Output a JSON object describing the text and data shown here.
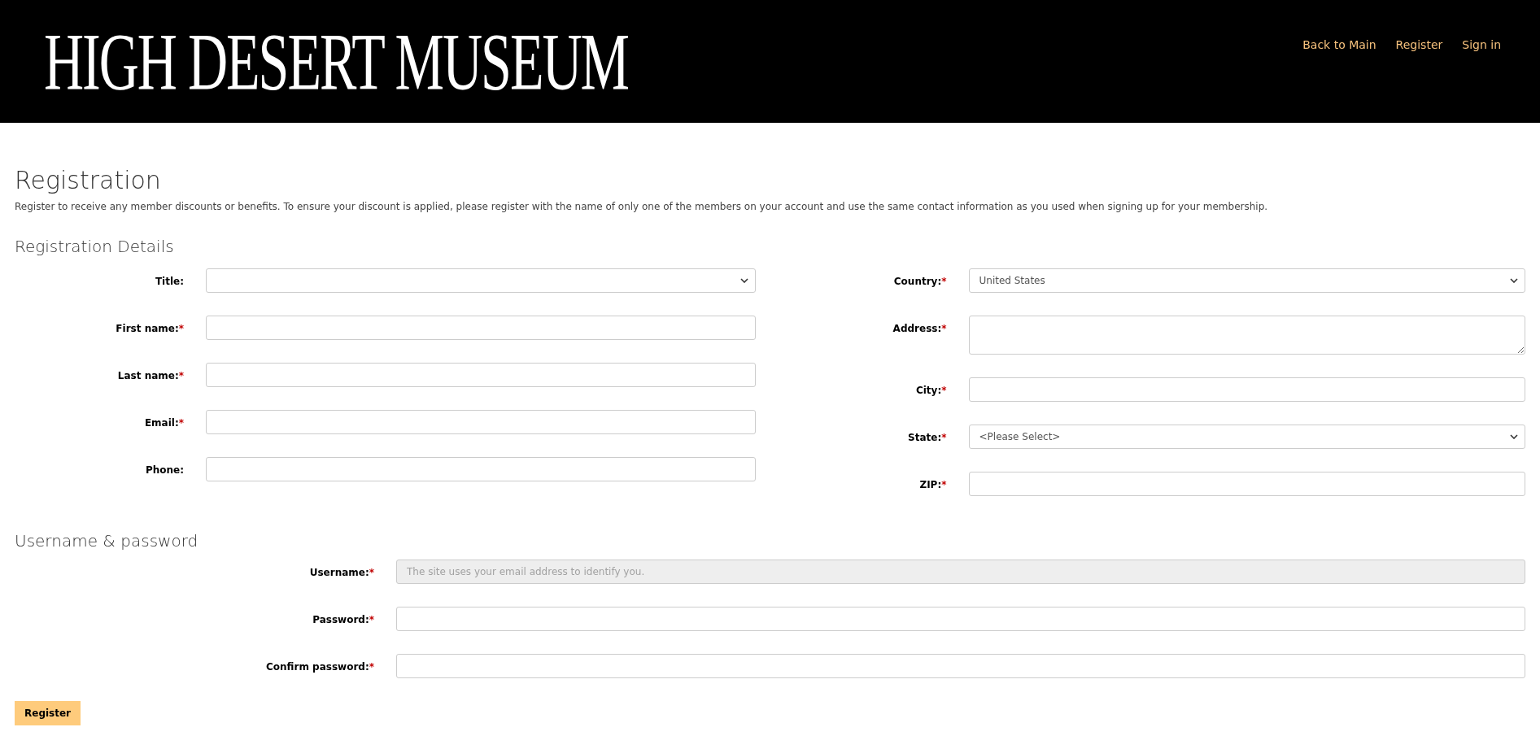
{
  "header": {
    "logo": "HIGH DESERT MUSEUM",
    "nav": [
      "Back to Main",
      "Register",
      "Sign in"
    ]
  },
  "page": {
    "title": "Registration",
    "description": "Register to receive any member discounts or benefits. To ensure your discount is applied, please register with the name of only one of the members on your account and use the same contact information as you used when signing up for your membership."
  },
  "details": {
    "heading": "Registration Details",
    "left_fields": [
      {
        "label": "Title:",
        "kind": "select"
      },
      {
        "label": "First name:",
        "marker": "*",
        "kind": "text"
      },
      {
        "label": "Last name:",
        "marker": "*",
        "kind": "text"
      },
      {
        "label": "Email:",
        "marker": "*",
        "kind": "text"
      },
      {
        "label": "Phone:",
        "kind": "text"
      }
    ],
    "right_fields": [
      {
        "label": "Country:",
        "marker": "*",
        "kind": "select",
        "value": "United States"
      },
      {
        "label": "Address:",
        "marker": "*",
        "kind": "textarea"
      },
      {
        "label": "City:",
        "marker": "*",
        "kind": "text"
      },
      {
        "label": "State:",
        "marker": "*",
        "kind": "select",
        "value": "<Please Select>"
      },
      {
        "label": "ZIP:",
        "marker": "*",
        "kind": "text"
      }
    ]
  },
  "account": {
    "heading": "Username & password",
    "fields": [
      {
        "label": "Username:",
        "marker": "*",
        "kind": "text",
        "disabled": true,
        "placeholder": "The site uses your email address to identify you."
      },
      {
        "label": "Password:",
        "marker": "*",
        "kind": "text",
        "disabled": false
      },
      {
        "label": "Confirm password:",
        "marker": "*",
        "kind": "text",
        "disabled": false
      }
    ]
  },
  "submit": "Register"
}
